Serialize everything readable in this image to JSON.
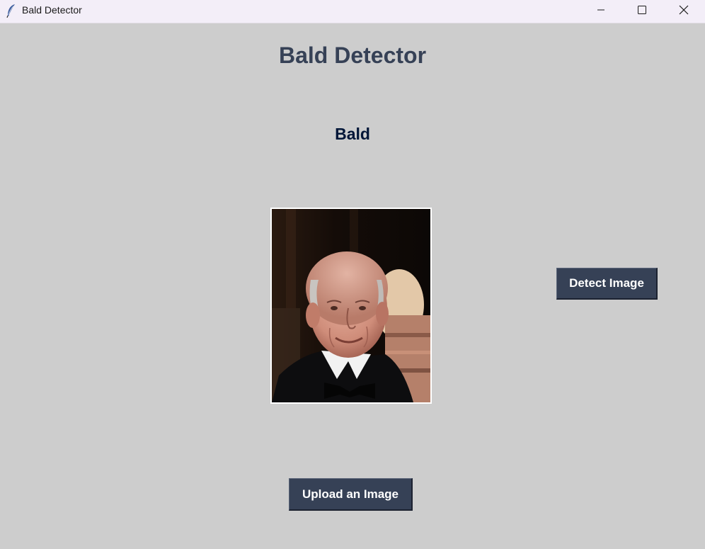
{
  "window": {
    "title": "Bald Detector",
    "icon": "feather-icon",
    "controls": [
      "minimize-icon",
      "maximize-icon",
      "close-icon"
    ]
  },
  "app": {
    "heading": "Bald Detector",
    "result": "Bald",
    "image_subject": "portrait photo of an elderly bald man in a tuxedo with a bow tie"
  },
  "buttons": {
    "detect": "Detect Image",
    "upload": "Upload an Image"
  },
  "colors": {
    "background": "#cdcdcd",
    "heading": "#364156",
    "result": "#011638",
    "button_bg": "#364156",
    "button_text": "#ffffff"
  }
}
